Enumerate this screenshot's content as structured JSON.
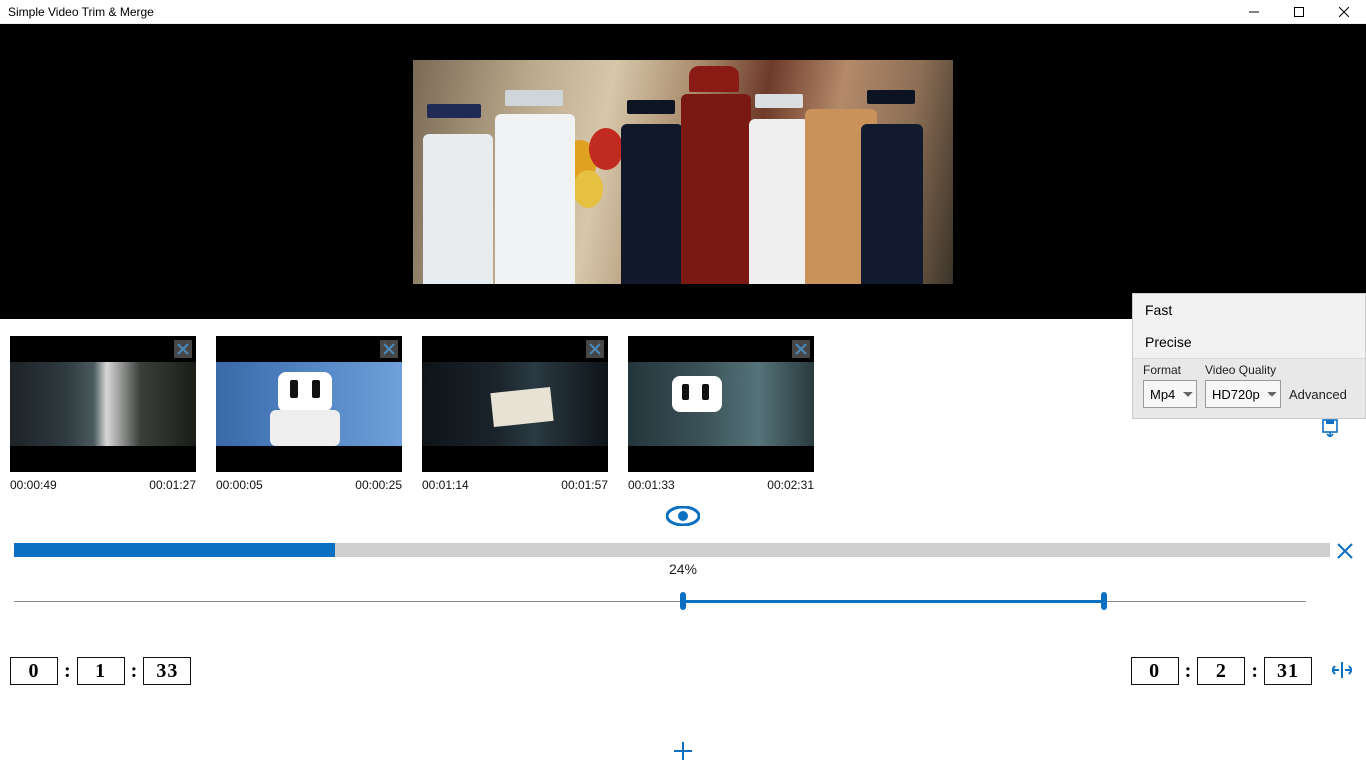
{
  "titlebar": {
    "title": "Simple Video Trim & Merge"
  },
  "panel": {
    "opt_fast": "Fast",
    "opt_precise": "Precise",
    "format_label": "Format",
    "format_value": "Mp4",
    "quality_label": "Video Quality",
    "quality_value": "HD720p",
    "advanced": "Advanced"
  },
  "clips": [
    {
      "start": "00:00:49",
      "end": "00:01:27"
    },
    {
      "start": "00:00:05",
      "end": "00:00:25"
    },
    {
      "start": "00:01:14",
      "end": "00:01:57"
    },
    {
      "start": "00:01:33",
      "end": "00:02:31"
    }
  ],
  "progress": {
    "percent": 24,
    "label": "24%"
  },
  "range": {
    "start_pct": 51.8,
    "end_pct": 84.4
  },
  "start_time": {
    "h": "0",
    "m": "1",
    "s": "33"
  },
  "end_time": {
    "h": "0",
    "m": "2",
    "s": "31"
  }
}
